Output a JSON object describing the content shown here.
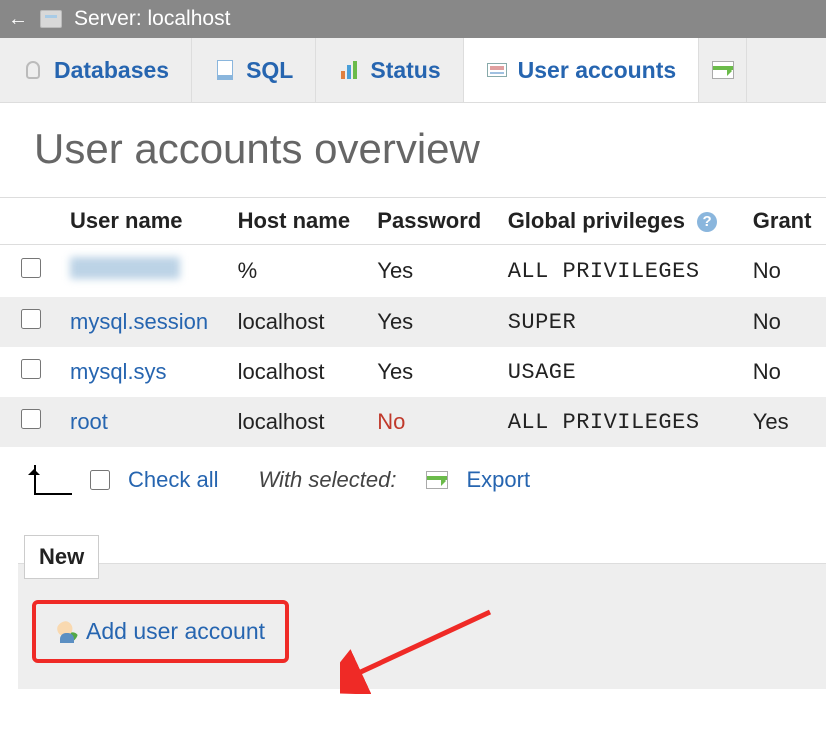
{
  "topbar": {
    "server_label": "Server: localhost"
  },
  "tabs": [
    {
      "label": "Databases",
      "active": false
    },
    {
      "label": "SQL",
      "active": false
    },
    {
      "label": "Status",
      "active": false
    },
    {
      "label": "User accounts",
      "active": true
    }
  ],
  "page_title": "User accounts overview",
  "table": {
    "columns": {
      "user": "User name",
      "host": "Host name",
      "password": "Password",
      "privileges": "Global privileges",
      "grant": "Grant"
    },
    "rows": [
      {
        "user": "",
        "user_blurred": true,
        "host": "%",
        "password": "Yes",
        "privileges": "ALL PRIVILEGES",
        "grant": "No"
      },
      {
        "user": "mysql.session",
        "host": "localhost",
        "password": "Yes",
        "privileges": "SUPER",
        "grant": "No"
      },
      {
        "user": "mysql.sys",
        "host": "localhost",
        "password": "Yes",
        "privileges": "USAGE",
        "grant": "No"
      },
      {
        "user": "root",
        "host": "localhost",
        "password": "No",
        "password_warn": true,
        "privileges": "ALL PRIVILEGES",
        "grant": "Yes"
      }
    ]
  },
  "actions": {
    "check_all": "Check all",
    "with_selected": "With selected:",
    "export": "Export"
  },
  "new_section": {
    "legend": "New",
    "add_user": "Add user account"
  }
}
